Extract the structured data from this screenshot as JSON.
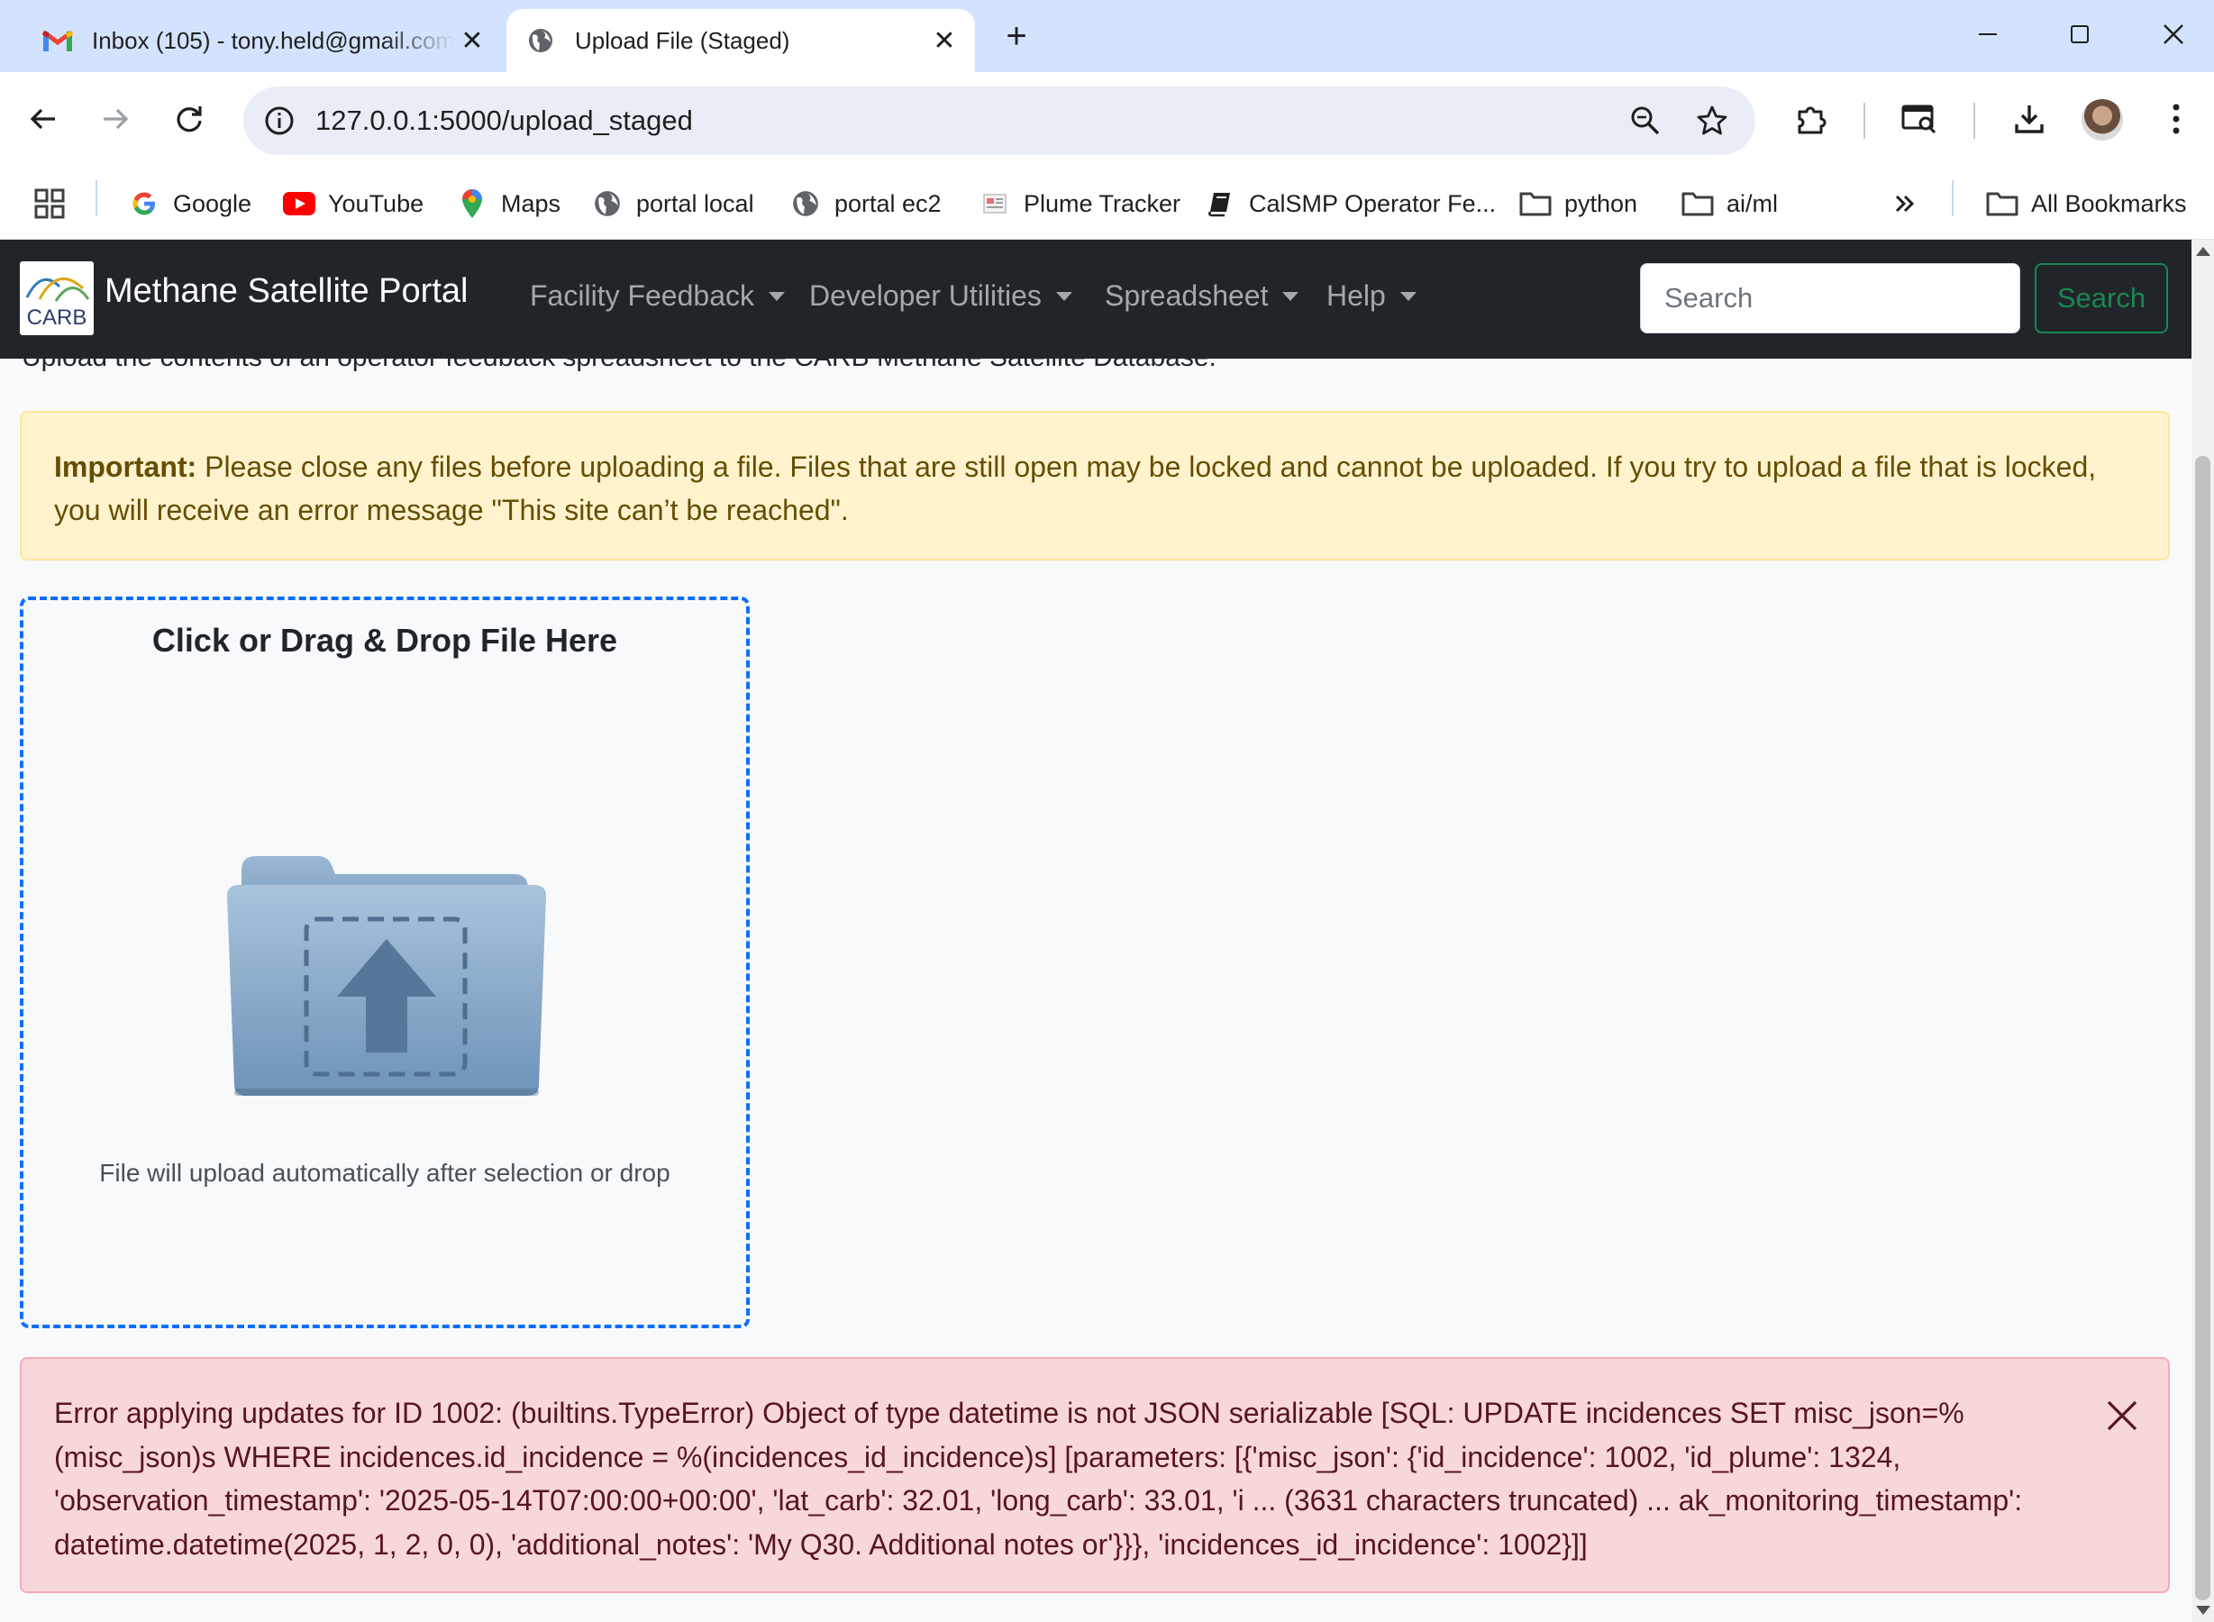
{
  "browser": {
    "tabs": [
      {
        "title": "Inbox (105) - tony.held@gmail.com",
        "icon": "gmail-icon",
        "active": false
      },
      {
        "title": "Upload File (Staged)",
        "icon": "globe-icon",
        "active": true
      }
    ],
    "url": "127.0.0.1:5000/upload_staged",
    "bookmarks": [
      {
        "label": "Google",
        "icon": "google-icon"
      },
      {
        "label": "YouTube",
        "icon": "youtube-icon"
      },
      {
        "label": "Maps",
        "icon": "maps-pin-icon"
      },
      {
        "label": "portal local",
        "icon": "globe-icon"
      },
      {
        "label": "portal ec2",
        "icon": "globe-icon"
      },
      {
        "label": "Plume Tracker",
        "icon": "plume-tracker-icon"
      },
      {
        "label": "CalSMP Operator Fe...",
        "icon": "book-icon"
      },
      {
        "label": "python",
        "icon": "folder-icon"
      },
      {
        "label": "ai/ml",
        "icon": "folder-icon"
      }
    ],
    "all_bookmarks": "All Bookmarks"
  },
  "navbar": {
    "logo_text": "CARB",
    "brand": "Methane Satellite Portal",
    "menus": [
      "Facility Feedback",
      "Developer Utilities",
      "Spreadsheet",
      "Help"
    ],
    "search_placeholder": "Search",
    "search_button": "Search"
  },
  "page": {
    "intro": "Upload the contents of an operator feedback spreadsheet to the CARB Methane Satellite Database.",
    "important_label": "Important:",
    "important_text": " Please close any files before uploading a file. Files that are still open may be locked and cannot be uploaded. If you try to upload a file that is locked, you will receive an error message \"This site can’t be reached\".",
    "dropzone_title": "Click or Drag & Drop File Here",
    "dropzone_hint": "File will upload automatically after selection or drop",
    "error_text": "Error applying updates for ID 1002: (builtins.TypeError) Object of type datetime is not JSON serializable [SQL: UPDATE incidences SET misc_json=%(misc_json)s WHERE incidences.id_incidence = %(incidences_id_incidence)s] [parameters: [{'misc_json': {'id_incidence': 1002, 'id_plume': 1324, 'observation_timestamp': '2025-05-14T07:00:00+00:00', 'lat_carb': 32.01, 'long_carb': 33.01, 'i ... (3631 characters truncated) ... ak_monitoring_timestamp': datetime.datetime(2025, 1, 2, 0, 0), 'additional_notes': 'My Q30. Additional notes or'}}}, 'incidences_id_incidence': 1002}]]"
  },
  "colors": {
    "tab_strip": "#d3e3fd",
    "navbar_bg": "#212529",
    "warning_bg": "#fff3cd",
    "danger_bg": "#f8d7da",
    "dropzone_border": "#0d6efd",
    "search_button": "#198754"
  }
}
